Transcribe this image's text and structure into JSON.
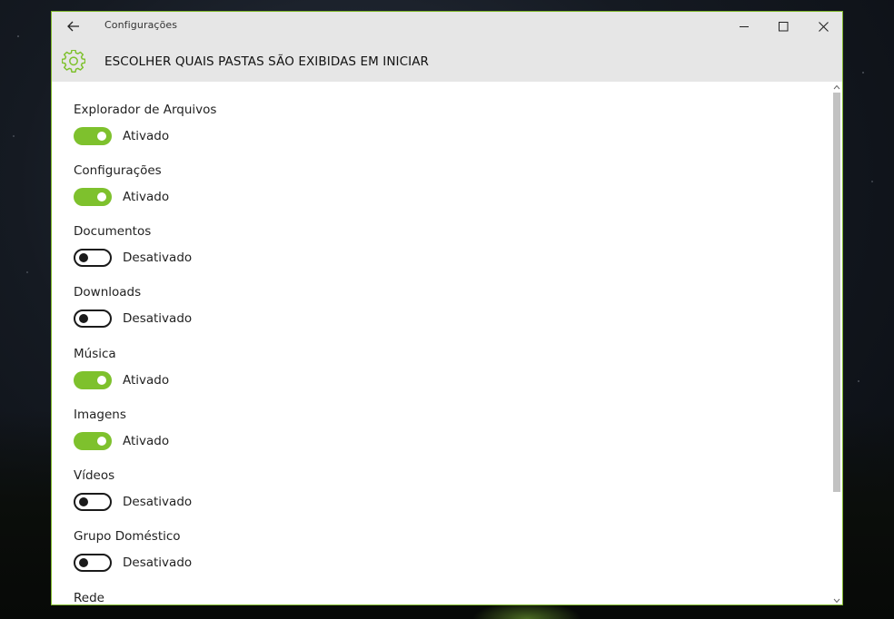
{
  "window": {
    "title": "Configurações",
    "accent_color": "#7ec12d"
  },
  "header": {
    "title": "ESCOLHER QUAIS PASTAS SÃO EXIBIDAS EM INICIAR",
    "icon": "gear-icon"
  },
  "settings": [
    {
      "label": "Explorador de Arquivos",
      "state": "on",
      "state_text": "Ativado"
    },
    {
      "label": "Configurações",
      "state": "on",
      "state_text": "Ativado"
    },
    {
      "label": "Documentos",
      "state": "off",
      "state_text": "Desativado"
    },
    {
      "label": "Downloads",
      "state": "off",
      "state_text": "Desativado"
    },
    {
      "label": "Música",
      "state": "on",
      "state_text": "Ativado"
    },
    {
      "label": "Imagens",
      "state": "on",
      "state_text": "Ativado"
    },
    {
      "label": "Vídeos",
      "state": "off",
      "state_text": "Desativado"
    },
    {
      "label": "Grupo Doméstico",
      "state": "off",
      "state_text": "Desativado"
    },
    {
      "label": "Rede"
    }
  ]
}
